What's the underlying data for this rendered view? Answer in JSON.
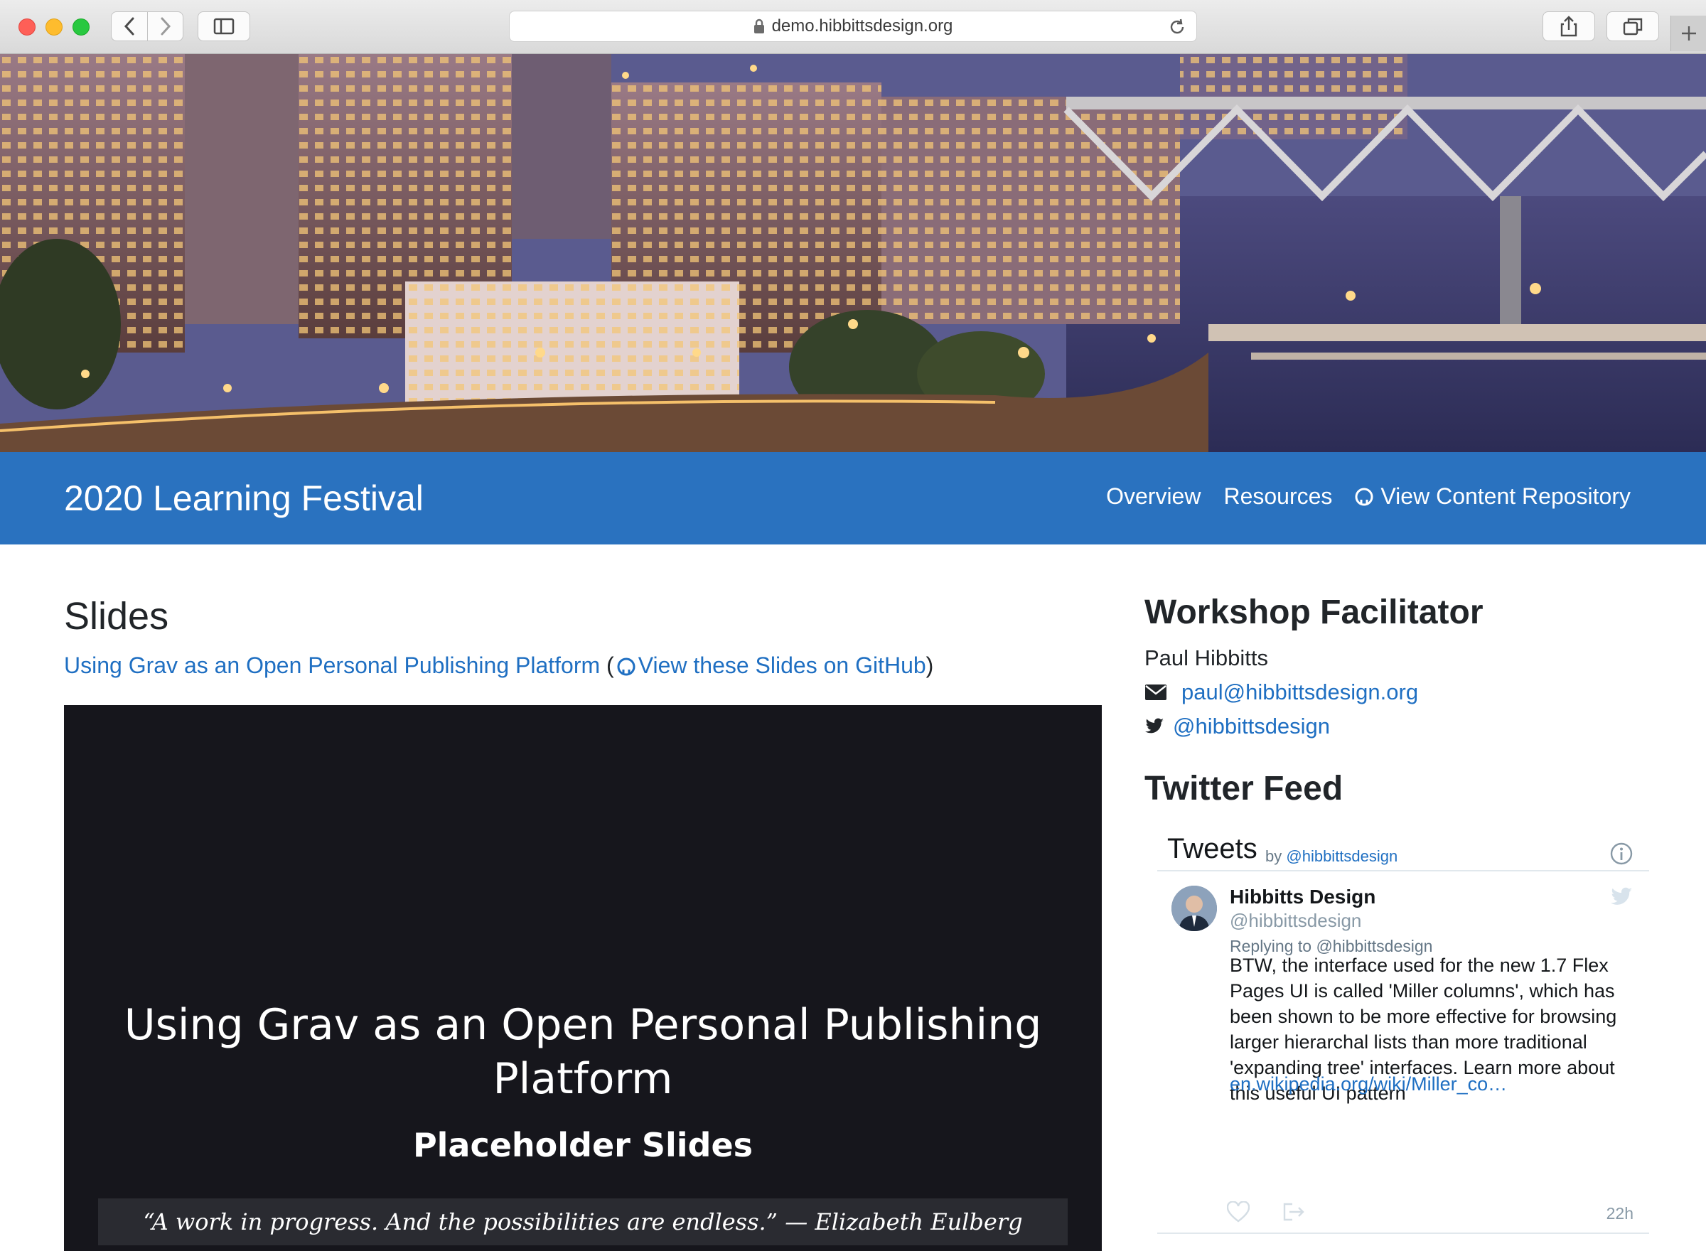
{
  "browser": {
    "url": "demo.hibbittsdesign.org"
  },
  "site": {
    "brand": "2020 Learning Festival",
    "nav": [
      "Overview",
      "Resources",
      "View Content Repository"
    ]
  },
  "slides": {
    "heading": "Slides",
    "link_main": "Using Grav as an Open Personal Publishing Platform",
    "paren_open": "(",
    "link_github": "View these Slides on GitHub",
    "paren_close": ")",
    "slide_title": "Using Grav as an Open Personal Publishing Platform",
    "slide_subtitle": "Placeholder Slides",
    "slide_quote": "“A work in progress. And the possibilities are endless.” — Elizabeth Eulberg"
  },
  "sidebar": {
    "facilitator_heading": "Workshop Facilitator",
    "name": "Paul Hibbitts",
    "email": "paul@hibbittsdesign.org",
    "twitter": "@hibbittsdesign",
    "feed_heading": "Twitter Feed"
  },
  "twitter_widget": {
    "title": "Tweets",
    "by_label": "by",
    "by_handle": "@hibbittsdesign",
    "tweet": {
      "author": "Hibbitts Design",
      "handle": "@hibbittsdesign",
      "replying_to": "Replying to @hibbittsdesign",
      "text": "BTW, the interface used for the new 1.7 Flex Pages UI is called 'Miller columns', which has been shown to be more effective for browsing larger hierarchal lists than more traditional 'expanding tree' interfaces. Learn more about this useful UI pattern",
      "link": "en.wikipedia.org/wiki/Miller_co…",
      "time": "22h"
    }
  },
  "colors": {
    "navbar": "#2a72bf",
    "link": "#1f6fc2",
    "slide_bg": "#16161c"
  }
}
